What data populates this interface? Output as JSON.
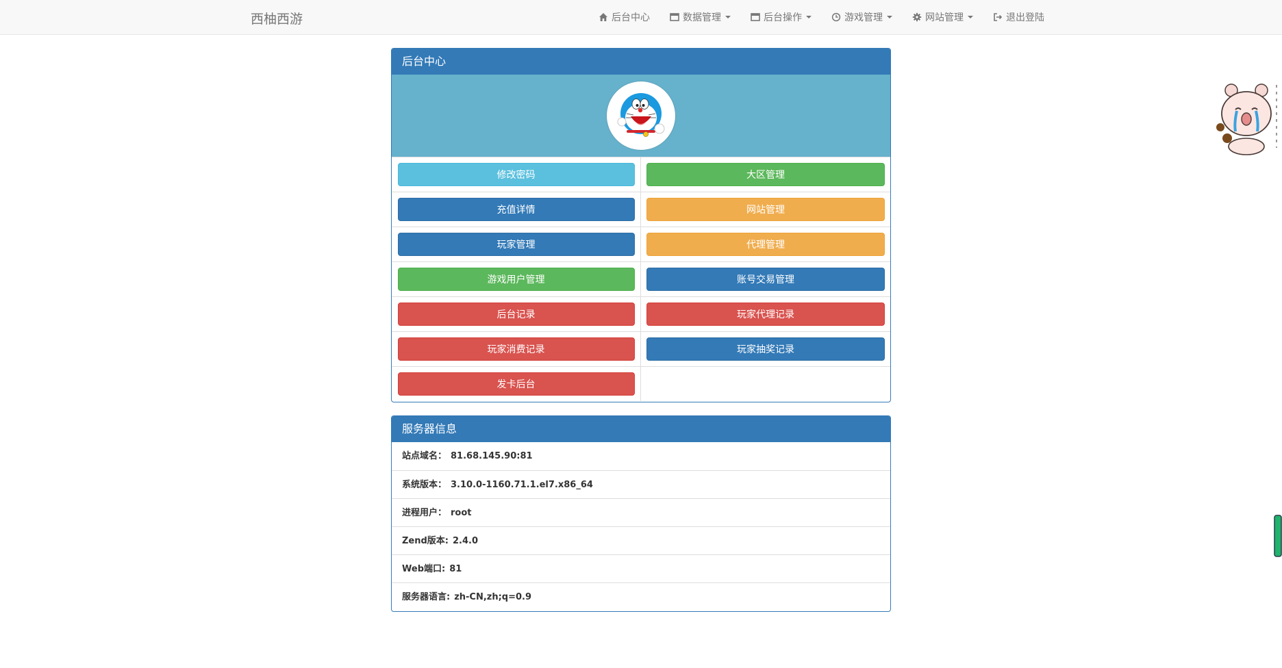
{
  "brand": "西柚西游",
  "nav": [
    {
      "label": "后台中心",
      "icon": "home-icon",
      "dropdown": false
    },
    {
      "label": "数据管理",
      "icon": "window-icon",
      "dropdown": true
    },
    {
      "label": "后台操作",
      "icon": "window-icon",
      "dropdown": true
    },
    {
      "label": "游戏管理",
      "icon": "clock-icon",
      "dropdown": true
    },
    {
      "label": "网站管理",
      "icon": "gear-icon",
      "dropdown": true
    },
    {
      "label": "退出登陆",
      "icon": "logout-icon",
      "dropdown": false
    }
  ],
  "admin_panel": {
    "title": "后台中心",
    "avatar_icon": "doraemon-avatar",
    "buttons": [
      {
        "label": "修改密码",
        "style": "info"
      },
      {
        "label": "大区管理",
        "style": "success"
      },
      {
        "label": "充值详情",
        "style": "primary"
      },
      {
        "label": "网站管理",
        "style": "warning"
      },
      {
        "label": "玩家管理",
        "style": "primary"
      },
      {
        "label": "代理管理",
        "style": "warning"
      },
      {
        "label": "游戏用户管理",
        "style": "success"
      },
      {
        "label": "账号交易管理",
        "style": "primary"
      },
      {
        "label": "后台记录",
        "style": "danger"
      },
      {
        "label": "玩家代理记录",
        "style": "danger"
      },
      {
        "label": "玩家消费记录",
        "style": "danger"
      },
      {
        "label": "玩家抽奖记录",
        "style": "primary"
      },
      {
        "label": "发卡后台",
        "style": "danger"
      }
    ]
  },
  "server_panel": {
    "title": "服务器信息",
    "rows": [
      {
        "label": "站点域名：",
        "value": "81.68.145.90:81"
      },
      {
        "label": "系统版本：",
        "value": "3.10.0-1160.71.1.el7.x86_64"
      },
      {
        "label": "进程用户：",
        "value": "root"
      },
      {
        "label": "Zend版本:",
        "value": "2.4.0"
      },
      {
        "label": "Web端口:",
        "value": "81"
      },
      {
        "label": "服务器语言:",
        "value": "zh-CN,zh;q=0.9"
      }
    ]
  },
  "colors": {
    "primary": "#337ab7",
    "banner": "#66b1cc",
    "info": "#5bc0de",
    "success": "#5cb85c",
    "warning": "#f0ad4e",
    "danger": "#d9534f"
  }
}
